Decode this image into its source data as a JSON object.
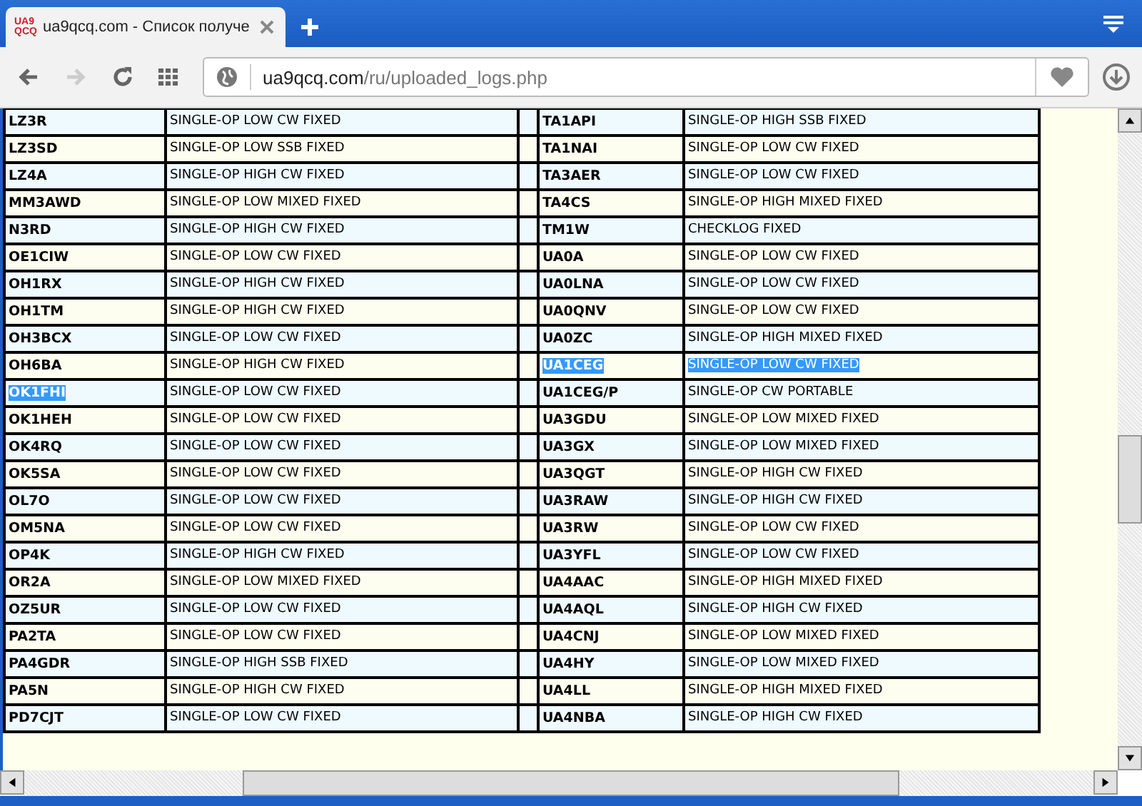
{
  "browser": {
    "tab": {
      "favicon_lines": [
        "UA9",
        "QCQ"
      ],
      "title": "ua9qcq.com - Список получе",
      "selected": true
    },
    "toolbar": {
      "back_disabled": false,
      "forward_disabled": true
    },
    "address": {
      "domain": "ua9qcq.com",
      "path": "/ru/uploaded_logs.php"
    }
  },
  "table": {
    "rows": [
      {
        "left": {
          "call": "LZ3R",
          "type": "SINGLE-OP LOW CW FIXED",
          "call_selected": false,
          "type_selected": false
        },
        "right": {
          "call": "TA1API",
          "type": "SINGLE-OP HIGH SSB FIXED",
          "call_selected": false,
          "type_selected": false
        }
      },
      {
        "left": {
          "call": "LZ3SD",
          "type": "SINGLE-OP LOW SSB FIXED",
          "call_selected": false,
          "type_selected": false
        },
        "right": {
          "call": "TA1NAI",
          "type": "SINGLE-OP LOW CW FIXED",
          "call_selected": false,
          "type_selected": false
        }
      },
      {
        "left": {
          "call": "LZ4A",
          "type": "SINGLE-OP HIGH CW FIXED",
          "call_selected": false,
          "type_selected": false
        },
        "right": {
          "call": "TA3AER",
          "type": "SINGLE-OP LOW CW FIXED",
          "call_selected": false,
          "type_selected": false
        }
      },
      {
        "left": {
          "call": "MM3AWD",
          "type": "SINGLE-OP LOW MIXED FIXED",
          "call_selected": false,
          "type_selected": false
        },
        "right": {
          "call": "TA4CS",
          "type": "SINGLE-OP HIGH MIXED FIXED",
          "call_selected": false,
          "type_selected": false
        }
      },
      {
        "left": {
          "call": "N3RD",
          "type": "SINGLE-OP HIGH CW FIXED",
          "call_selected": false,
          "type_selected": false
        },
        "right": {
          "call": "TM1W",
          "type": "CHECKLOG FIXED",
          "call_selected": false,
          "type_selected": false
        }
      },
      {
        "left": {
          "call": "OE1CIW",
          "type": "SINGLE-OP LOW CW FIXED",
          "call_selected": false,
          "type_selected": false
        },
        "right": {
          "call": "UA0A",
          "type": "SINGLE-OP LOW CW FIXED",
          "call_selected": false,
          "type_selected": false
        }
      },
      {
        "left": {
          "call": "OH1RX",
          "type": "SINGLE-OP HIGH CW FIXED",
          "call_selected": false,
          "type_selected": false
        },
        "right": {
          "call": "UA0LNA",
          "type": "SINGLE-OP LOW CW FIXED",
          "call_selected": false,
          "type_selected": false
        }
      },
      {
        "left": {
          "call": "OH1TM",
          "type": "SINGLE-OP HIGH CW FIXED",
          "call_selected": false,
          "type_selected": false
        },
        "right": {
          "call": "UA0QNV",
          "type": "SINGLE-OP LOW CW FIXED",
          "call_selected": false,
          "type_selected": false
        }
      },
      {
        "left": {
          "call": "OH3BCX",
          "type": "SINGLE-OP LOW CW FIXED",
          "call_selected": false,
          "type_selected": false
        },
        "right": {
          "call": "UA0ZC",
          "type": "SINGLE-OP HIGH MIXED FIXED",
          "call_selected": false,
          "type_selected": false
        }
      },
      {
        "left": {
          "call": "OH6BA",
          "type": "SINGLE-OP HIGH CW FIXED",
          "call_selected": false,
          "type_selected": false
        },
        "right": {
          "call": "UA1CEG",
          "type": "SINGLE-OP LOW CW FIXED",
          "call_selected": true,
          "type_selected": true
        }
      },
      {
        "left": {
          "call": "OK1FHI",
          "type": "SINGLE-OP LOW CW FIXED",
          "call_selected": true,
          "type_selected": false
        },
        "right": {
          "call": "UA1CEG/P",
          "type": "SINGLE-OP CW PORTABLE",
          "call_selected": false,
          "type_selected": false
        }
      },
      {
        "left": {
          "call": "OK1HEH",
          "type": "SINGLE-OP LOW CW FIXED",
          "call_selected": false,
          "type_selected": false
        },
        "right": {
          "call": "UA3GDU",
          "type": "SINGLE-OP LOW MIXED FIXED",
          "call_selected": false,
          "type_selected": false
        }
      },
      {
        "left": {
          "call": "OK4RQ",
          "type": "SINGLE-OP LOW CW FIXED",
          "call_selected": false,
          "type_selected": false
        },
        "right": {
          "call": "UA3GX",
          "type": "SINGLE-OP LOW MIXED FIXED",
          "call_selected": false,
          "type_selected": false
        }
      },
      {
        "left": {
          "call": "OK5SA",
          "type": "SINGLE-OP LOW CW FIXED",
          "call_selected": false,
          "type_selected": false
        },
        "right": {
          "call": "UA3QGT",
          "type": "SINGLE-OP HIGH CW FIXED",
          "call_selected": false,
          "type_selected": false
        }
      },
      {
        "left": {
          "call": "OL7O",
          "type": "SINGLE-OP LOW CW FIXED",
          "call_selected": false,
          "type_selected": false
        },
        "right": {
          "call": "UA3RAW",
          "type": "SINGLE-OP HIGH CW FIXED",
          "call_selected": false,
          "type_selected": false
        }
      },
      {
        "left": {
          "call": "OM5NA",
          "type": "SINGLE-OP LOW CW FIXED",
          "call_selected": false,
          "type_selected": false
        },
        "right": {
          "call": "UA3RW",
          "type": "SINGLE-OP LOW CW FIXED",
          "call_selected": false,
          "type_selected": false
        }
      },
      {
        "left": {
          "call": "OP4K",
          "type": "SINGLE-OP HIGH CW FIXED",
          "call_selected": false,
          "type_selected": false
        },
        "right": {
          "call": "UA3YFL",
          "type": "SINGLE-OP LOW CW FIXED",
          "call_selected": false,
          "type_selected": false
        }
      },
      {
        "left": {
          "call": "OR2A",
          "type": "SINGLE-OP LOW MIXED FIXED",
          "call_selected": false,
          "type_selected": false
        },
        "right": {
          "call": "UA4AAC",
          "type": "SINGLE-OP HIGH MIXED FIXED",
          "call_selected": false,
          "type_selected": false
        }
      },
      {
        "left": {
          "call": "OZ5UR",
          "type": "SINGLE-OP LOW CW FIXED",
          "call_selected": false,
          "type_selected": false
        },
        "right": {
          "call": "UA4AQL",
          "type": "SINGLE-OP HIGH CW FIXED",
          "call_selected": false,
          "type_selected": false
        }
      },
      {
        "left": {
          "call": "PA2TA",
          "type": "SINGLE-OP LOW CW FIXED",
          "call_selected": false,
          "type_selected": false
        },
        "right": {
          "call": "UA4CNJ",
          "type": "SINGLE-OP LOW MIXED FIXED",
          "call_selected": false,
          "type_selected": false
        }
      },
      {
        "left": {
          "call": "PA4GDR",
          "type": "SINGLE-OP HIGH SSB FIXED",
          "call_selected": false,
          "type_selected": false
        },
        "right": {
          "call": "UA4HY",
          "type": "SINGLE-OP LOW MIXED FIXED",
          "call_selected": false,
          "type_selected": false
        }
      },
      {
        "left": {
          "call": "PA5N",
          "type": "SINGLE-OP HIGH CW FIXED",
          "call_selected": false,
          "type_selected": false
        },
        "right": {
          "call": "UA4LL",
          "type": "SINGLE-OP HIGH MIXED FIXED",
          "call_selected": false,
          "type_selected": false
        }
      },
      {
        "left": {
          "call": "PD7CJT",
          "type": "SINGLE-OP LOW CW FIXED",
          "call_selected": false,
          "type_selected": false
        },
        "right": {
          "call": "UA4NBA",
          "type": "SINGLE-OP HIGH CW FIXED",
          "call_selected": false,
          "type_selected": false
        }
      }
    ]
  }
}
